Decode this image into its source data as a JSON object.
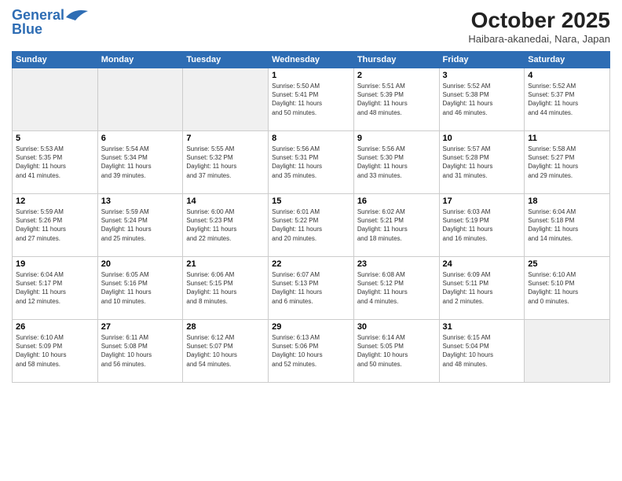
{
  "header": {
    "logo_line1": "General",
    "logo_line2": "Blue",
    "month": "October 2025",
    "location": "Haibara-akanedai, Nara, Japan"
  },
  "weekdays": [
    "Sunday",
    "Monday",
    "Tuesday",
    "Wednesday",
    "Thursday",
    "Friday",
    "Saturday"
  ],
  "weeks": [
    [
      {
        "day": "",
        "info": ""
      },
      {
        "day": "",
        "info": ""
      },
      {
        "day": "",
        "info": ""
      },
      {
        "day": "1",
        "info": "Sunrise: 5:50 AM\nSunset: 5:41 PM\nDaylight: 11 hours\nand 50 minutes."
      },
      {
        "day": "2",
        "info": "Sunrise: 5:51 AM\nSunset: 5:39 PM\nDaylight: 11 hours\nand 48 minutes."
      },
      {
        "day": "3",
        "info": "Sunrise: 5:52 AM\nSunset: 5:38 PM\nDaylight: 11 hours\nand 46 minutes."
      },
      {
        "day": "4",
        "info": "Sunrise: 5:52 AM\nSunset: 5:37 PM\nDaylight: 11 hours\nand 44 minutes."
      }
    ],
    [
      {
        "day": "5",
        "info": "Sunrise: 5:53 AM\nSunset: 5:35 PM\nDaylight: 11 hours\nand 41 minutes."
      },
      {
        "day": "6",
        "info": "Sunrise: 5:54 AM\nSunset: 5:34 PM\nDaylight: 11 hours\nand 39 minutes."
      },
      {
        "day": "7",
        "info": "Sunrise: 5:55 AM\nSunset: 5:32 PM\nDaylight: 11 hours\nand 37 minutes."
      },
      {
        "day": "8",
        "info": "Sunrise: 5:56 AM\nSunset: 5:31 PM\nDaylight: 11 hours\nand 35 minutes."
      },
      {
        "day": "9",
        "info": "Sunrise: 5:56 AM\nSunset: 5:30 PM\nDaylight: 11 hours\nand 33 minutes."
      },
      {
        "day": "10",
        "info": "Sunrise: 5:57 AM\nSunset: 5:28 PM\nDaylight: 11 hours\nand 31 minutes."
      },
      {
        "day": "11",
        "info": "Sunrise: 5:58 AM\nSunset: 5:27 PM\nDaylight: 11 hours\nand 29 minutes."
      }
    ],
    [
      {
        "day": "12",
        "info": "Sunrise: 5:59 AM\nSunset: 5:26 PM\nDaylight: 11 hours\nand 27 minutes."
      },
      {
        "day": "13",
        "info": "Sunrise: 5:59 AM\nSunset: 5:24 PM\nDaylight: 11 hours\nand 25 minutes."
      },
      {
        "day": "14",
        "info": "Sunrise: 6:00 AM\nSunset: 5:23 PM\nDaylight: 11 hours\nand 22 minutes."
      },
      {
        "day": "15",
        "info": "Sunrise: 6:01 AM\nSunset: 5:22 PM\nDaylight: 11 hours\nand 20 minutes."
      },
      {
        "day": "16",
        "info": "Sunrise: 6:02 AM\nSunset: 5:21 PM\nDaylight: 11 hours\nand 18 minutes."
      },
      {
        "day": "17",
        "info": "Sunrise: 6:03 AM\nSunset: 5:19 PM\nDaylight: 11 hours\nand 16 minutes."
      },
      {
        "day": "18",
        "info": "Sunrise: 6:04 AM\nSunset: 5:18 PM\nDaylight: 11 hours\nand 14 minutes."
      }
    ],
    [
      {
        "day": "19",
        "info": "Sunrise: 6:04 AM\nSunset: 5:17 PM\nDaylight: 11 hours\nand 12 minutes."
      },
      {
        "day": "20",
        "info": "Sunrise: 6:05 AM\nSunset: 5:16 PM\nDaylight: 11 hours\nand 10 minutes."
      },
      {
        "day": "21",
        "info": "Sunrise: 6:06 AM\nSunset: 5:15 PM\nDaylight: 11 hours\nand 8 minutes."
      },
      {
        "day": "22",
        "info": "Sunrise: 6:07 AM\nSunset: 5:13 PM\nDaylight: 11 hours\nand 6 minutes."
      },
      {
        "day": "23",
        "info": "Sunrise: 6:08 AM\nSunset: 5:12 PM\nDaylight: 11 hours\nand 4 minutes."
      },
      {
        "day": "24",
        "info": "Sunrise: 6:09 AM\nSunset: 5:11 PM\nDaylight: 11 hours\nand 2 minutes."
      },
      {
        "day": "25",
        "info": "Sunrise: 6:10 AM\nSunset: 5:10 PM\nDaylight: 11 hours\nand 0 minutes."
      }
    ],
    [
      {
        "day": "26",
        "info": "Sunrise: 6:10 AM\nSunset: 5:09 PM\nDaylight: 10 hours\nand 58 minutes."
      },
      {
        "day": "27",
        "info": "Sunrise: 6:11 AM\nSunset: 5:08 PM\nDaylight: 10 hours\nand 56 minutes."
      },
      {
        "day": "28",
        "info": "Sunrise: 6:12 AM\nSunset: 5:07 PM\nDaylight: 10 hours\nand 54 minutes."
      },
      {
        "day": "29",
        "info": "Sunrise: 6:13 AM\nSunset: 5:06 PM\nDaylight: 10 hours\nand 52 minutes."
      },
      {
        "day": "30",
        "info": "Sunrise: 6:14 AM\nSunset: 5:05 PM\nDaylight: 10 hours\nand 50 minutes."
      },
      {
        "day": "31",
        "info": "Sunrise: 6:15 AM\nSunset: 5:04 PM\nDaylight: 10 hours\nand 48 minutes."
      },
      {
        "day": "",
        "info": ""
      }
    ]
  ]
}
